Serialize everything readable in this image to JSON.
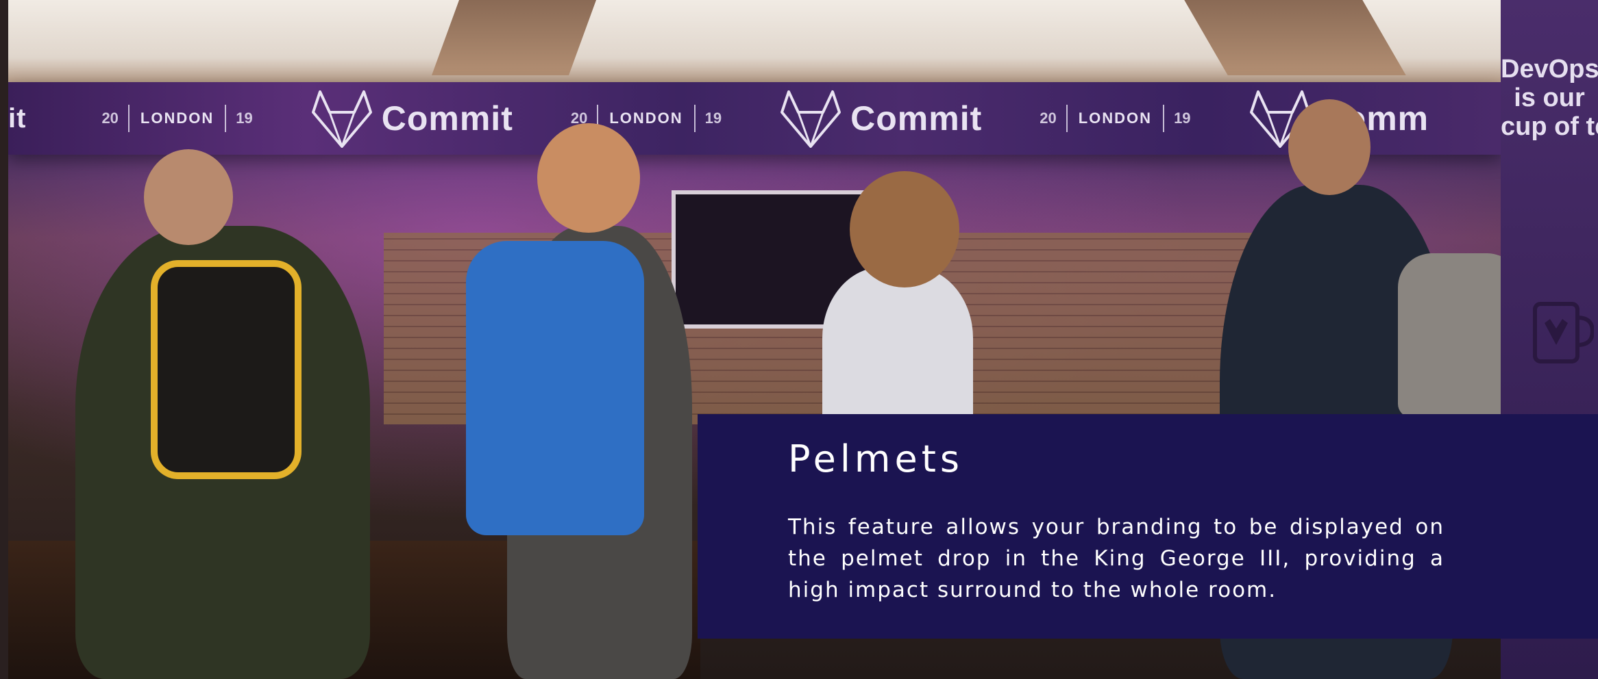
{
  "banner": {
    "repeats": [
      {
        "num_left": "20",
        "city": "LONDON",
        "num_right": "19",
        "brand": "Commit"
      },
      {
        "num_left": "20",
        "city": "LONDON",
        "num_right": "19",
        "brand": "Commit"
      },
      {
        "num_left": "20",
        "city": "LONDON",
        "num_right": "19",
        "brand": "Comm"
      }
    ],
    "leading_fragment": "it"
  },
  "side_banner": {
    "lines": [
      "DevOps",
      "is our",
      "cup of tea"
    ]
  },
  "panel": {
    "title": "Pelmets",
    "body": "This feature allows your branding to be displayed on the pelmet drop in the King  George III, providing a high impact  surround to the whole room."
  },
  "colors": {
    "panel_background": "#1b1451",
    "panel_text": "#ffffff",
    "banner_purple": "#4b2b6d"
  }
}
